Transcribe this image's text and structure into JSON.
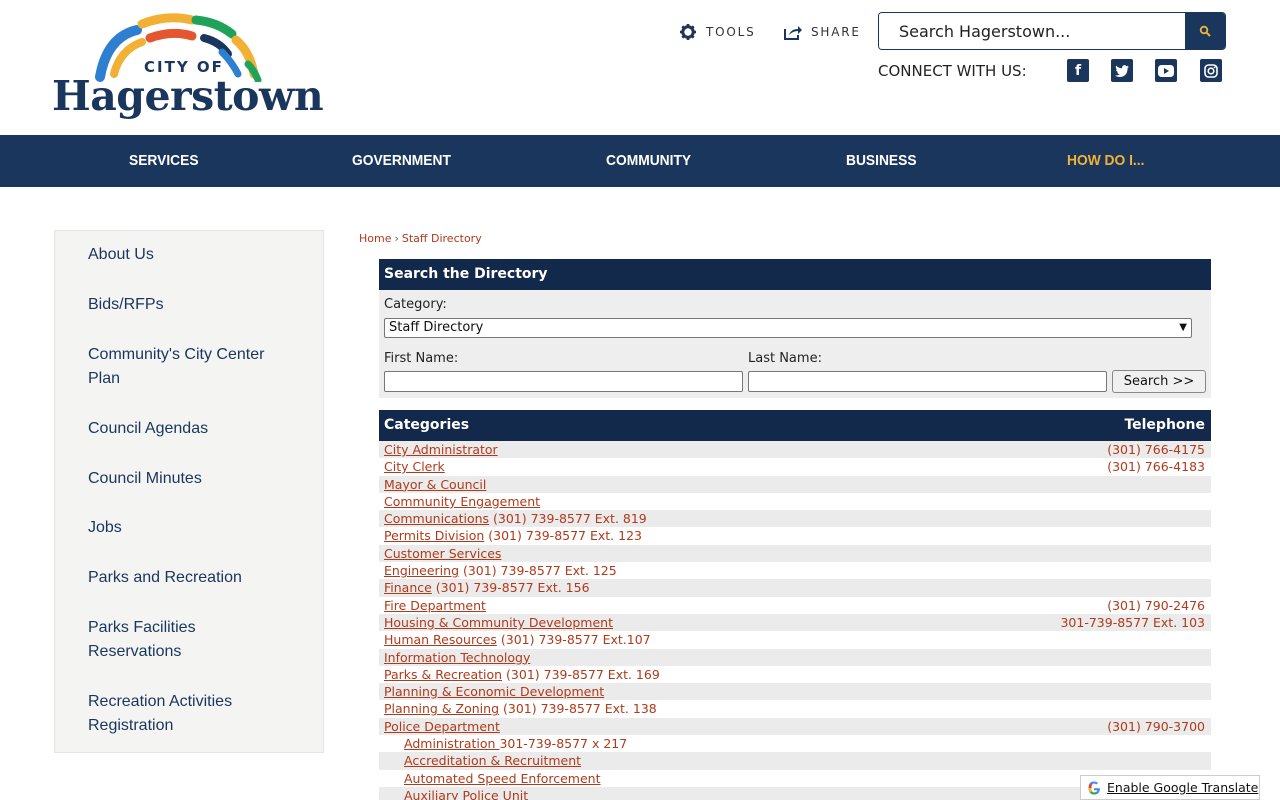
{
  "header": {
    "logo": {
      "city_of": "CITY OF",
      "name": "Hagerstown"
    },
    "tools_label": "TOOLS",
    "share_label": "SHARE",
    "search_placeholder": "Search Hagerstown...",
    "connect_label": "CONNECT WITH US:",
    "social": [
      "facebook-icon",
      "twitter-icon",
      "youtube-icon",
      "instagram-icon"
    ],
    "colors": {
      "primary": "#1a365d",
      "accent": "#f2b134",
      "link": "#b03a1a"
    }
  },
  "nav": [
    {
      "label": "SERVICES"
    },
    {
      "label": "GOVERNMENT"
    },
    {
      "label": "COMMUNITY"
    },
    {
      "label": "BUSINESS"
    },
    {
      "label": "HOW DO I..."
    }
  ],
  "sidebar": [
    {
      "label": "About Us"
    },
    {
      "label": "Bids/RFPs"
    },
    {
      "label": "Community's City Center Plan"
    },
    {
      "label": "Council Agendas"
    },
    {
      "label": "Council Minutes"
    },
    {
      "label": "Jobs"
    },
    {
      "label": "Parks and Recreation"
    },
    {
      "label": "Parks Facilities Reservations"
    },
    {
      "label": "Recreation Activities Registration"
    }
  ],
  "breadcrumb": {
    "home": "Home",
    "sep": "›",
    "current": "Staff Directory"
  },
  "search_directory": {
    "title": "Search the Directory",
    "category_label": "Category:",
    "category_value": "Staff Directory",
    "first_name_label": "First Name:",
    "last_name_label": "Last Name:",
    "search_button": "Search >>"
  },
  "categories": {
    "col_category": "Categories",
    "col_telephone": "Telephone",
    "rows": [
      {
        "name": "City Administrator",
        "inline": "",
        "phone": "(301) 766-4175"
      },
      {
        "name": "City Clerk",
        "inline": "",
        "phone": "(301) 766-4183"
      },
      {
        "name": "Mayor & Council",
        "inline": "",
        "phone": ""
      },
      {
        "name": "Community Engagement",
        "inline": "",
        "phone": ""
      },
      {
        "name": "Communications",
        "inline": " (301) 739-8577 Ext. 819",
        "phone": ""
      },
      {
        "name": "Permits Division",
        "inline": " (301) 739-8577 Ext. 123",
        "phone": ""
      },
      {
        "name": "Customer Services",
        "inline": "",
        "phone": ""
      },
      {
        "name": "Engineering",
        "inline": " (301) 739-8577 Ext. 125",
        "phone": ""
      },
      {
        "name": "Finance",
        "inline": " (301) 739-8577 Ext. 156",
        "phone": ""
      },
      {
        "name": "Fire Department",
        "inline": "",
        "phone": "(301) 790-2476"
      },
      {
        "name": "Housing & Community Development",
        "inline": "",
        "phone": "301-739-8577 Ext. 103"
      },
      {
        "name": "Human Resources",
        "inline": " (301) 739-8577 Ext.107",
        "phone": ""
      },
      {
        "name": "Information Technology",
        "inline": "",
        "phone": ""
      },
      {
        "name": "Parks & Recreation",
        "inline": " (301) 739-8577 Ext. 169",
        "phone": ""
      },
      {
        "name": "Planning & Economic Development",
        "inline": "",
        "phone": ""
      },
      {
        "name": "Planning & Zoning",
        "inline": " (301) 739-8577 Ext. 138",
        "phone": ""
      },
      {
        "name": "Police Department",
        "inline": "",
        "phone": "(301) 790-3700"
      },
      {
        "name": "Administration ",
        "inline": "301-739-8577 x 217",
        "phone": "",
        "sub": true
      },
      {
        "name": "Accreditation & Recruitment",
        "inline": "",
        "phone": "",
        "sub": true
      },
      {
        "name": "Automated Speed Enforcement",
        "inline": "",
        "phone": "",
        "sub": true
      },
      {
        "name": "Auxiliary Police Unit",
        "inline": "",
        "phone": "",
        "sub": true
      }
    ]
  },
  "translate": {
    "label": "Enable Google Translate"
  }
}
